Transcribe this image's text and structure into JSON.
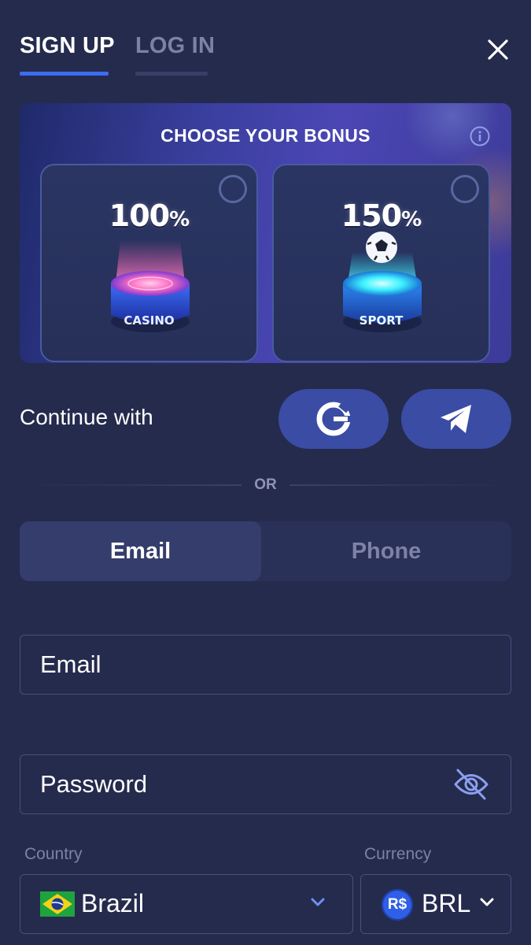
{
  "tabs": {
    "signup": "SIGN UP",
    "login": "LOG IN"
  },
  "bonus": {
    "title": "CHOOSE YOUR BONUS",
    "cards": [
      {
        "percent": "100",
        "unit": "%",
        "label": "CASINO"
      },
      {
        "percent": "150",
        "unit": "%",
        "label": "SPORT"
      }
    ]
  },
  "social": {
    "continue_label": "Continue with"
  },
  "divider": {
    "or": "OR"
  },
  "method": {
    "email": "Email",
    "phone": "Phone"
  },
  "form": {
    "email_placeholder": "Email",
    "password_placeholder": "Password",
    "country_label": "Country",
    "country_value": "Brazil",
    "currency_label": "Currency",
    "currency_value": "BRL",
    "currency_symbol": "R$"
  },
  "colors": {
    "background": "#252b4d",
    "accent": "#3d6cf0",
    "button": "#3a4ca3",
    "muted_text": "#7c81a6"
  },
  "icons": [
    "close-icon",
    "info-icon",
    "google-icon",
    "telegram-icon",
    "eye-off-icon",
    "chevron-down-icon",
    "brazil-flag-icon"
  ]
}
